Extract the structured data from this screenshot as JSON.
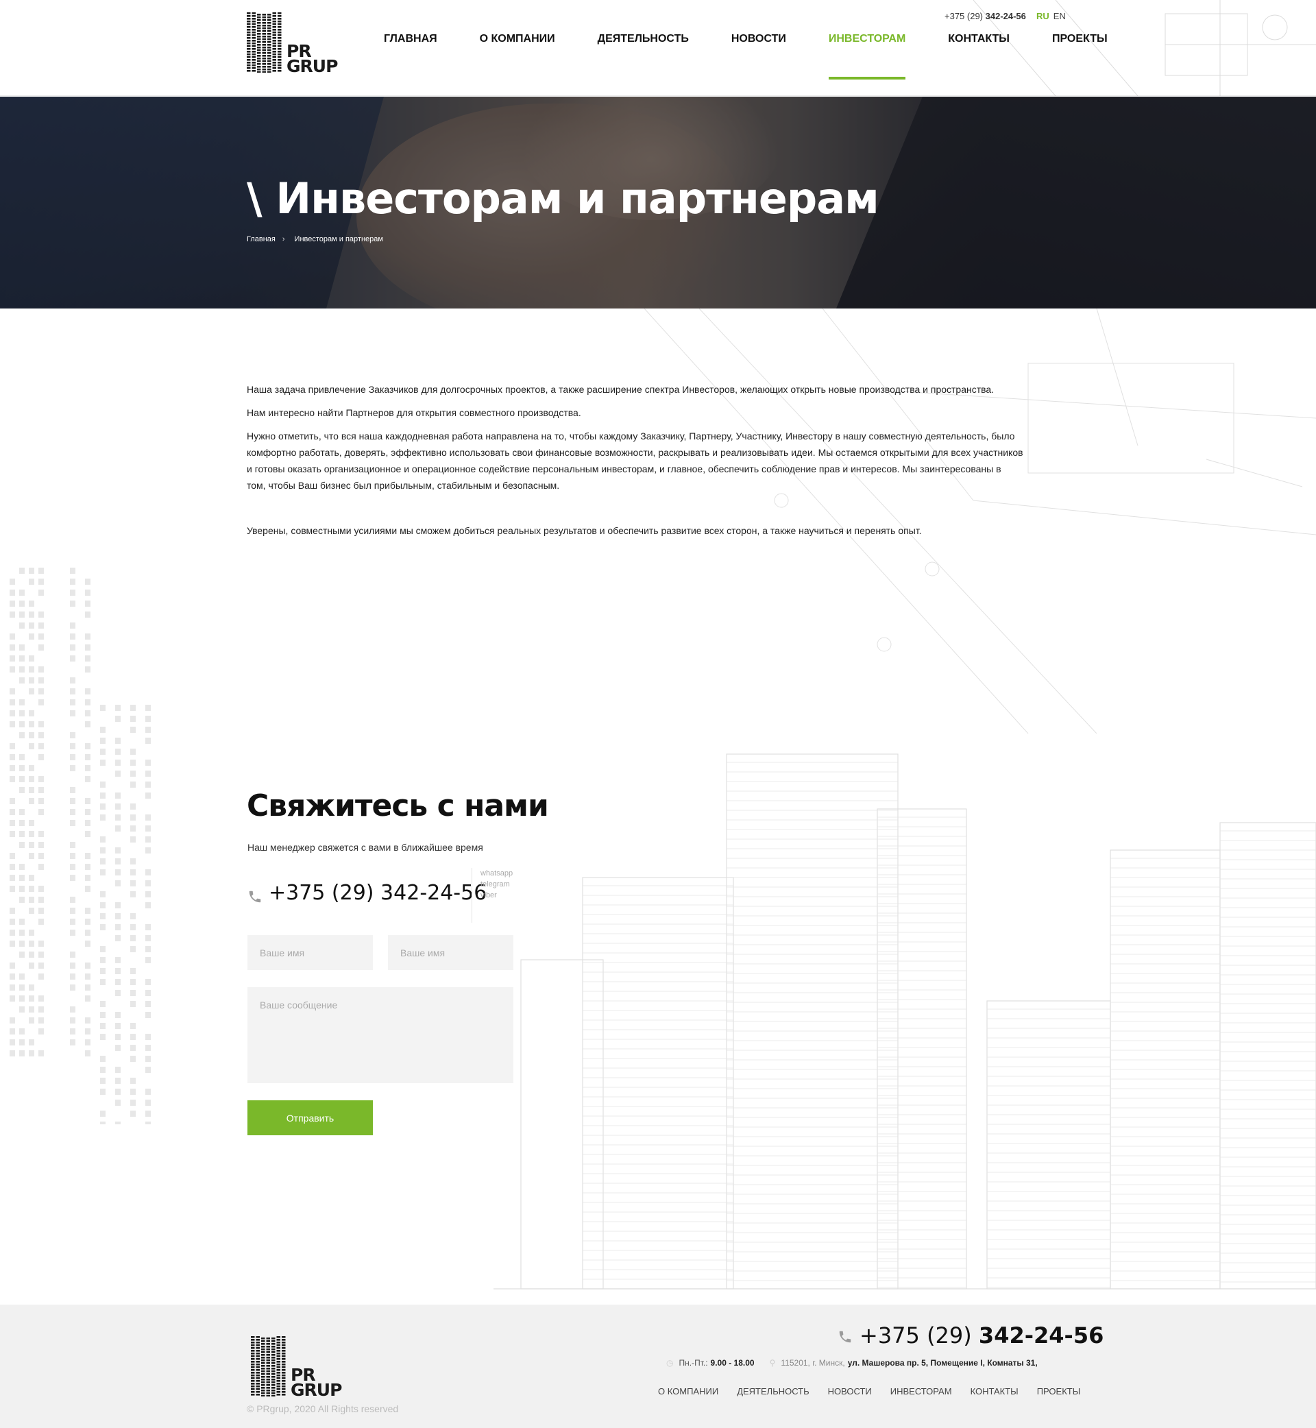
{
  "header": {
    "logo_text_line1": "PR",
    "logo_text_line2": "GRUP",
    "phone_prefix": "+375 (29) ",
    "phone_main": "342-24-56",
    "lang_ru": "RU",
    "lang_en": "EN",
    "nav": [
      {
        "label": "ГЛАВНАЯ"
      },
      {
        "label": "О КОМПАНИИ"
      },
      {
        "label": "ДЕЯТЕЛЬНОСТЬ"
      },
      {
        "label": "НОВОСТИ"
      },
      {
        "label": "ИНВЕСТОРАМ",
        "active": true
      },
      {
        "label": "КОНТАКТЫ"
      },
      {
        "label": "ПРОЕКТЫ"
      }
    ]
  },
  "hero": {
    "title": "\\ Инвесторам и партнерам",
    "breadcrumb": [
      "Главная",
      "Инвесторам и партнерам"
    ]
  },
  "content": {
    "p1": "Наша задача привлечение Заказчиков для долгосрочных проектов, а также расширение спектра Инвесторов, желающих открыть новые производства и пространства.",
    "p2": "Нам интересно найти Партнеров для открытия совместного производства.",
    "p3_lines": [
      "Нужно отметить, что вся наша каждодневная работа направлена на то, чтобы каждому Заказчику, Партнеру, Участнику, Инвестору в нашу совместную деятельность, было",
      "комфортно работать, доверять, эффективно использовать свои финансовые возможности, раскрывать и реализовывать идеи. Мы остаемся открытыми для всех участников",
      "и готовы оказать организационное и операционное содействие персональным инвесторам, и главное, обеспечить соблюдение прав и интересов. Мы заинтересованы в",
      "том, чтобы Ваш бизнес был прибыльным, стабильным и безопасным."
    ],
    "p4": "Уверены, совместными усилиями мы сможем добиться реальных результатов и обеспечить развитие всех сторон, а также научиться и перенять опыт."
  },
  "contact": {
    "title": "Свяжитесь с нами",
    "subtitle": "Наш менеджер свяжется с вами в ближайшее время",
    "phone": "+375 (29) 342-24-56",
    "messengers": [
      "whatsapp",
      "telegram",
      "viber"
    ],
    "name_placeholder_1": "Ваше имя",
    "name_placeholder_2": "Ваше имя",
    "message_placeholder": "Ваше сообщение",
    "submit_label": "Отправить"
  },
  "footer": {
    "copyright": "© PRgrup, 2020 All Rights reserved",
    "phone_prefix": "+375 (29) ",
    "phone_main": "342-24-56",
    "hours_label": "Пн.-Пт.:",
    "hours_value": "9.00 - 18.00",
    "address_gray": "115201, г. Минск,",
    "address_bold": "ул. Машерова пр. 5, Помещение I, Комнаты 31,",
    "nav": [
      "О КОМПАНИИ",
      "ДЕЯТЕЛЬНОСТЬ",
      "НОВОСТИ",
      "ИНВЕСТОРАМ",
      "КОНТАКТЫ",
      "ПРОЕКТЫ"
    ]
  },
  "colors": {
    "accent": "#7ab82a",
    "text": "#222222",
    "input_bg": "#f3f3f3",
    "footer_bg": "#f1f1f1"
  },
  "icons": [
    "building-logo-icon",
    "phone-icon",
    "clock-icon",
    "location-pin-icon",
    "chevron-right-icon"
  ]
}
